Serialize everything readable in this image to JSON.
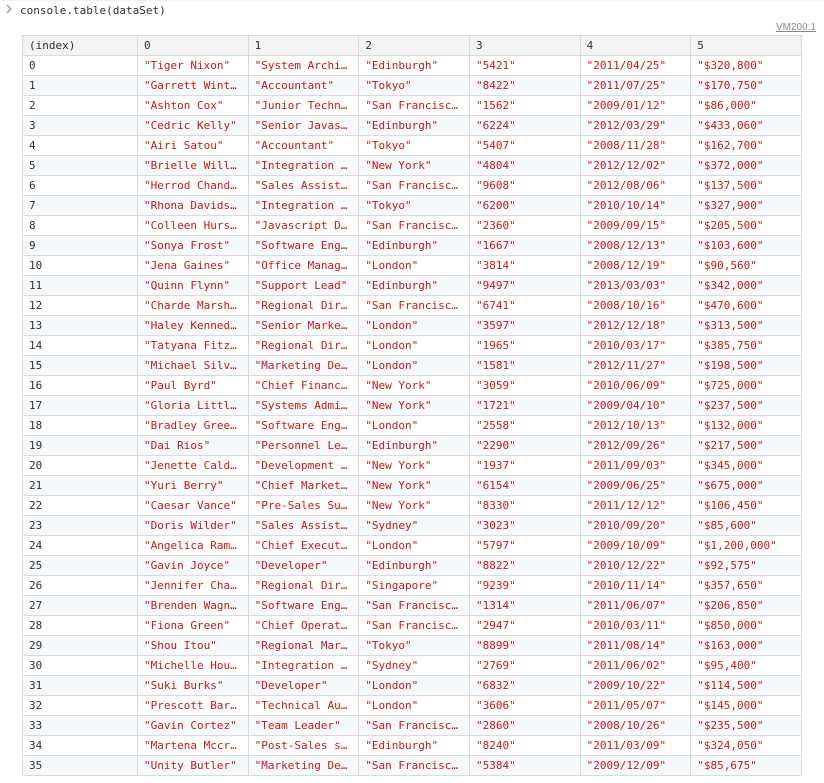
{
  "prompt": {
    "code": "console.table(dataSet)"
  },
  "sourceLink": "VM200:1",
  "table": {
    "headers": [
      "(index)",
      "0",
      "1",
      "2",
      "3",
      "4",
      "5"
    ],
    "rows": [
      {
        "index": "0",
        "cells": [
          "\"Tiger Nixon\"",
          "\"System Archit…",
          "\"Edinburgh\"",
          "\"5421\"",
          "\"2011/04/25\"",
          "\"$320,800\""
        ]
      },
      {
        "index": "1",
        "cells": [
          "\"Garrett Winte…",
          "\"Accountant\"",
          "\"Tokyo\"",
          "\"8422\"",
          "\"2011/07/25\"",
          "\"$170,750\""
        ]
      },
      {
        "index": "2",
        "cells": [
          "\"Ashton Cox\"",
          "\"Junior Techni…",
          "\"San Francisco\"",
          "\"1562\"",
          "\"2009/01/12\"",
          "\"$86,000\""
        ]
      },
      {
        "index": "3",
        "cells": [
          "\"Cedric Kelly\"",
          "\"Senior Javasc…",
          "\"Edinburgh\"",
          "\"6224\"",
          "\"2012/03/29\"",
          "\"$433,060\""
        ]
      },
      {
        "index": "4",
        "cells": [
          "\"Airi Satou\"",
          "\"Accountant\"",
          "\"Tokyo\"",
          "\"5407\"",
          "\"2008/11/28\"",
          "\"$162,700\""
        ]
      },
      {
        "index": "5",
        "cells": [
          "\"Brielle Willi…",
          "\"Integration S…",
          "\"New York\"",
          "\"4804\"",
          "\"2012/12/02\"",
          "\"$372,000\""
        ]
      },
      {
        "index": "6",
        "cells": [
          "\"Herrod Chandl…",
          "\"Sales Assista…",
          "\"San Francisco\"",
          "\"9608\"",
          "\"2012/08/06\"",
          "\"$137,500\""
        ]
      },
      {
        "index": "7",
        "cells": [
          "\"Rhona Davidso…",
          "\"Integration S…",
          "\"Tokyo\"",
          "\"6200\"",
          "\"2010/10/14\"",
          "\"$327,900\""
        ]
      },
      {
        "index": "8",
        "cells": [
          "\"Colleen Hurst\"",
          "\"Javascript De…",
          "\"San Francisco\"",
          "\"2360\"",
          "\"2009/09/15\"",
          "\"$205,500\""
        ]
      },
      {
        "index": "9",
        "cells": [
          "\"Sonya Frost\"",
          "\"Software Engi…",
          "\"Edinburgh\"",
          "\"1667\"",
          "\"2008/12/13\"",
          "\"$103,600\""
        ]
      },
      {
        "index": "10",
        "cells": [
          "\"Jena Gaines\"",
          "\"Office Manage…",
          "\"London\"",
          "\"3814\"",
          "\"2008/12/19\"",
          "\"$90,560\""
        ]
      },
      {
        "index": "11",
        "cells": [
          "\"Quinn Flynn\"",
          "\"Support Lead\"",
          "\"Edinburgh\"",
          "\"9497\"",
          "\"2013/03/03\"",
          "\"$342,000\""
        ]
      },
      {
        "index": "12",
        "cells": [
          "\"Charde Marsha…",
          "\"Regional Dire…",
          "\"San Francisco\"",
          "\"6741\"",
          "\"2008/10/16\"",
          "\"$470,600\""
        ]
      },
      {
        "index": "13",
        "cells": [
          "\"Haley Kennedy\"",
          "\"Senior Market…",
          "\"London\"",
          "\"3597\"",
          "\"2012/12/18\"",
          "\"$313,500\""
        ]
      },
      {
        "index": "14",
        "cells": [
          "\"Tatyana Fitzp…",
          "\"Regional Dire…",
          "\"London\"",
          "\"1965\"",
          "\"2010/03/17\"",
          "\"$385,750\""
        ]
      },
      {
        "index": "15",
        "cells": [
          "\"Michael Silva\"",
          "\"Marketing Des…",
          "\"London\"",
          "\"1581\"",
          "\"2012/11/27\"",
          "\"$198,500\""
        ]
      },
      {
        "index": "16",
        "cells": [
          "\"Paul Byrd\"",
          "\"Chief Financi…",
          "\"New York\"",
          "\"3059\"",
          "\"2010/06/09\"",
          "\"$725,000\""
        ]
      },
      {
        "index": "17",
        "cells": [
          "\"Gloria Little\"",
          "\"Systems Admin…",
          "\"New York\"",
          "\"1721\"",
          "\"2009/04/10\"",
          "\"$237,500\""
        ]
      },
      {
        "index": "18",
        "cells": [
          "\"Bradley Greer\"",
          "\"Software Engi…",
          "\"London\"",
          "\"2558\"",
          "\"2012/10/13\"",
          "\"$132,000\""
        ]
      },
      {
        "index": "19",
        "cells": [
          "\"Dai Rios\"",
          "\"Personnel Lea…",
          "\"Edinburgh\"",
          "\"2290\"",
          "\"2012/09/26\"",
          "\"$217,500\""
        ]
      },
      {
        "index": "20",
        "cells": [
          "\"Jenette Caldw…",
          "\"Development L…",
          "\"New York\"",
          "\"1937\"",
          "\"2011/09/03\"",
          "\"$345,000\""
        ]
      },
      {
        "index": "21",
        "cells": [
          "\"Yuri Berry\"",
          "\"Chief Marketi…",
          "\"New York\"",
          "\"6154\"",
          "\"2009/06/25\"",
          "\"$675,000\""
        ]
      },
      {
        "index": "22",
        "cells": [
          "\"Caesar Vance\"",
          "\"Pre-Sales Sup…",
          "\"New York\"",
          "\"8330\"",
          "\"2011/12/12\"",
          "\"$106,450\""
        ]
      },
      {
        "index": "23",
        "cells": [
          "\"Doris Wilder\"",
          "\"Sales Assista…",
          "\"Sydney\"",
          "\"3023\"",
          "\"2010/09/20\"",
          "\"$85,600\""
        ]
      },
      {
        "index": "24",
        "cells": [
          "\"Angelica Ramo…",
          "\"Chief Executi…",
          "\"London\"",
          "\"5797\"",
          "\"2009/10/09\"",
          "\"$1,200,000\""
        ]
      },
      {
        "index": "25",
        "cells": [
          "\"Gavin Joyce\"",
          "\"Developer\"",
          "\"Edinburgh\"",
          "\"8822\"",
          "\"2010/12/22\"",
          "\"$92,575\""
        ]
      },
      {
        "index": "26",
        "cells": [
          "\"Jennifer Chan…",
          "\"Regional Dire…",
          "\"Singapore\"",
          "\"9239\"",
          "\"2010/11/14\"",
          "\"$357,650\""
        ]
      },
      {
        "index": "27",
        "cells": [
          "\"Brenden Wagne…",
          "\"Software Engi…",
          "\"San Francisco\"",
          "\"1314\"",
          "\"2011/06/07\"",
          "\"$206,850\""
        ]
      },
      {
        "index": "28",
        "cells": [
          "\"Fiona Green\"",
          "\"Chief Operati…",
          "\"San Francisco\"",
          "\"2947\"",
          "\"2010/03/11\"",
          "\"$850,000\""
        ]
      },
      {
        "index": "29",
        "cells": [
          "\"Shou Itou\"",
          "\"Regional Mark…",
          "\"Tokyo\"",
          "\"8899\"",
          "\"2011/08/14\"",
          "\"$163,000\""
        ]
      },
      {
        "index": "30",
        "cells": [
          "\"Michelle Hous…",
          "\"Integration S…",
          "\"Sydney\"",
          "\"2769\"",
          "\"2011/06/02\"",
          "\"$95,400\""
        ]
      },
      {
        "index": "31",
        "cells": [
          "\"Suki Burks\"",
          "\"Developer\"",
          "\"London\"",
          "\"6832\"",
          "\"2009/10/22\"",
          "\"$114,500\""
        ]
      },
      {
        "index": "32",
        "cells": [
          "\"Prescott Bart…",
          "\"Technical Aut…",
          "\"London\"",
          "\"3606\"",
          "\"2011/05/07\"",
          "\"$145,000\""
        ]
      },
      {
        "index": "33",
        "cells": [
          "\"Gavin Cortez\"",
          "\"Team Leader\"",
          "\"San Francisco\"",
          "\"2860\"",
          "\"2008/10/26\"",
          "\"$235,500\""
        ]
      },
      {
        "index": "34",
        "cells": [
          "\"Martena Mccra…",
          "\"Post-Sales su…",
          "\"Edinburgh\"",
          "\"8240\"",
          "\"2011/03/09\"",
          "\"$324,050\""
        ]
      },
      {
        "index": "35",
        "cells": [
          "\"Unity Butler\"",
          "\"Marketing Des…",
          "\"San Francisco\"",
          "\"5384\"",
          "\"2009/12/09\"",
          "\"$85,675\""
        ]
      }
    ]
  }
}
